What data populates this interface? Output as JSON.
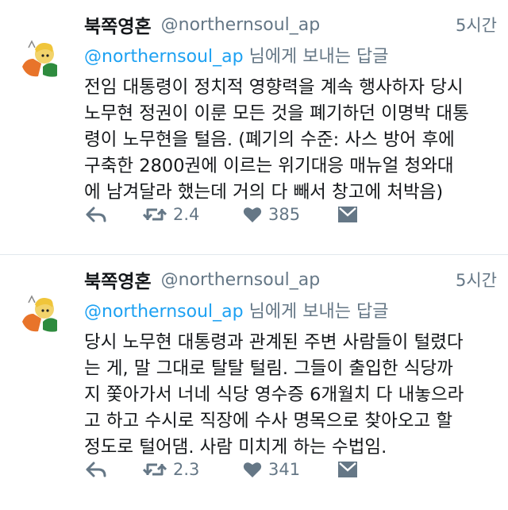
{
  "tweets": [
    {
      "name": "북쪽영혼",
      "handle": "@northernsoul_ap",
      "time": "5시간",
      "reply_mention": "@northernsoul_ap",
      "reply_suffix": " 님에게 보내는 답글",
      "lines": [
        "전임 대통령이 정치적 영향력을 계속 행사하자 당시",
        "노무현 정권이 이룬 모든 것을 폐기하던 이명박 대통",
        "령이 노무현을 털음. (폐기의 수준: 사스 방어 후에",
        "구축한 2800권에 이르는 위기대응 매뉴얼 청와대",
        "에 남겨달라 했는데 거의 다 빼서 창고에 처박음)"
      ],
      "retweets": "2.4",
      "likes": "385"
    },
    {
      "name": "북쪽영혼",
      "handle": "@northernsoul_ap",
      "time": "5시간",
      "reply_mention": "@northernsoul_ap",
      "reply_suffix": " 님에게 보내는 답글",
      "lines": [
        "당시 노무현 대통령과 관계된 주변 사람들이 털렸다",
        "는 게,  말 그대로 탈탈 털림. 그들이 출입한 식당까",
        "지 쫓아가서 너네 식당 영수증 6개월치 다 내놓으라",
        "고 하고 수시로 직장에 수사 명목으로 찾아오고 할",
        "정도로 털어댐. 사람 미치게 하는 수법임."
      ],
      "retweets": "2.3",
      "likes": "341"
    }
  ],
  "icons": {
    "reply": "reply-icon",
    "retweet": "retweet-icon",
    "like": "heart-icon",
    "message": "envelope-icon",
    "avatar": "cartoon-avatar"
  },
  "colors": {
    "mention": "#1da1f2",
    "secondary_text": "#657786",
    "primary_text": "#14171a",
    "divider": "#e1e8ed"
  }
}
